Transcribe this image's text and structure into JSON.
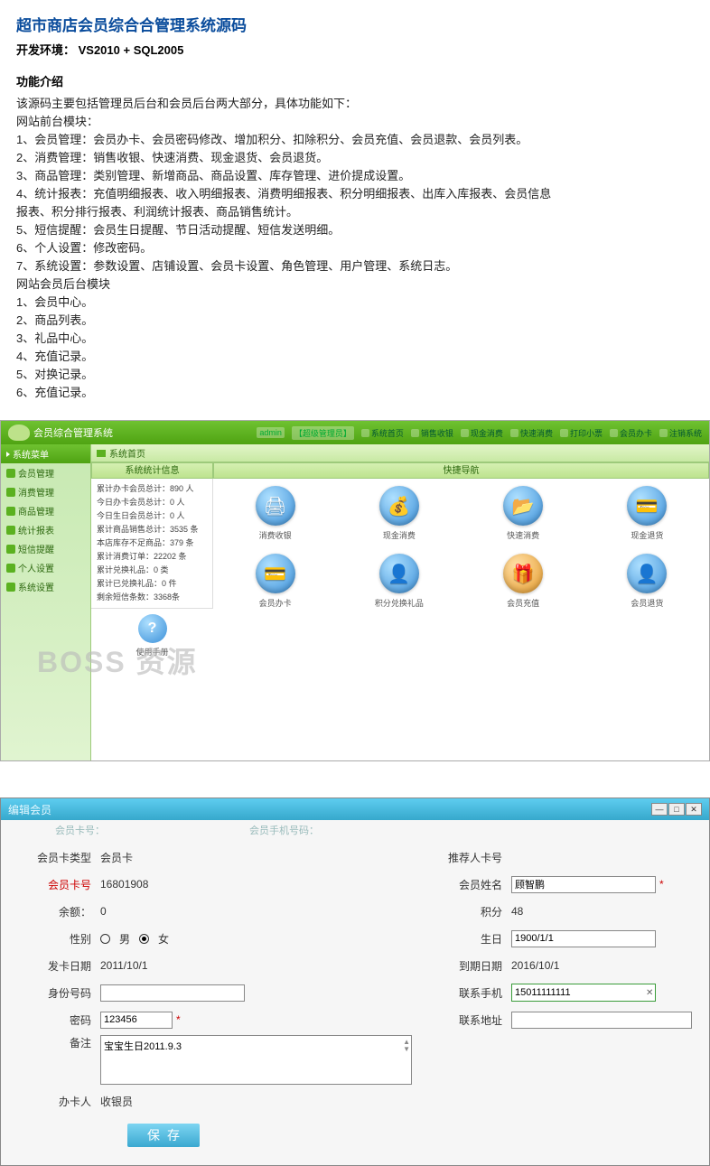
{
  "doc": {
    "title": "超市商店会员综合合管理系统源码",
    "env": "开发环境： VS2010 + SQL2005",
    "section": "功能介绍",
    "lines": [
      "该源码主要包括管理员后台和会员后台两大部分，具体功能如下：",
      "网站前台模块：",
      "1、会员管理：会员办卡、会员密码修改、增加积分、扣除积分、会员充值、会员退款、会员列表。",
      "2、消费管理：销售收银、快速消费、现金退货、会员退货。",
      "3、商品管理：类别管理、新增商品、商品设置、库存管理、进价提成设置。",
      "4、统计报表：充值明细报表、收入明细报表、消费明细报表、积分明细报表、出库入库报表、会员信息",
      "报表、积分排行报表、利润统计报表、商品销售统计。",
      "5、短信提醒：会员生日提醒、节日活动提醒、短信发送明细。",
      "6、个人设置：修改密码。",
      "7、系统设置：参数设置、店铺设置、会员卡设置、角色管理、用户管理、系统日志。",
      "网站会员后台模块",
      "1、会员中心。",
      "2、商品列表。",
      "3、礼品中心。",
      "4、充值记录。",
      "5、对换记录。",
      "6、充值记录。"
    ]
  },
  "shot1": {
    "logo": "会员综合管理系统",
    "top_user": "admin",
    "top_role": "【超级管理员】",
    "top_links": [
      "系统首页",
      "销售收银",
      "现金消费",
      "快速消费",
      "打印小票",
      "会员办卡",
      "注销系统"
    ],
    "side_header": "系统菜单",
    "side_items": [
      "会员管理",
      "消费管理",
      "商品管理",
      "统计报表",
      "短信提醒",
      "个人设置",
      "系统设置"
    ],
    "crumb": "系统首页",
    "split": {
      "left": "系统统计信息",
      "right": "快捷导航"
    },
    "stats": [
      "累计办卡会员总计：890 人",
      "今日办卡会员总计：0 人",
      "今日生日会员总计：0 人",
      "累计商品销售总计：3535 条",
      "本店库存不足商品：379 条",
      "累计消费订单：22202 条",
      "累计兑换礼品：0 类",
      "累计已兑换礼品：0 件",
      "剩余短信条数：3368条"
    ],
    "icons_row1": [
      "消费收银",
      "现金消费",
      "快速消费",
      "现金退货"
    ],
    "icons_row2": [
      "会员办卡",
      "积分兑换礼品",
      "会员充值",
      "会员退货"
    ],
    "help_label": "使用手册",
    "watermark": "BOSS 资源"
  },
  "shot2": {
    "win_title": "编辑会员",
    "faint_left": "会员卡号：",
    "faint_right": "会员手机号码：",
    "left_fields": {
      "card_type_label": "会员卡类型",
      "card_type_value": "会员卡",
      "card_no_label": "会员卡号",
      "card_no_value": "16801908",
      "balance_label": "余额：",
      "balance_value": "0",
      "gender_label": "性别",
      "gender_male": "男",
      "gender_female": "女",
      "issue_label": "发卡日期",
      "issue_value": "2011/10/1",
      "idcard_label": "身份号码",
      "pwd_label": "密码",
      "pwd_value": "123456",
      "remark_label": "备注",
      "remark_value": "宝宝生日2011.9.3",
      "clerk_label": "办卡人",
      "clerk_value": "收银员",
      "save": "保存"
    },
    "right_fields": {
      "ref_label": "推荐人卡号",
      "name_label": "会员姓名",
      "name_value": "顾智鹏",
      "points_label": "积分",
      "points_value": "48",
      "birth_label": "生日",
      "birth_value": "1900/1/1",
      "expire_label": "到期日期",
      "expire_value": "2016/10/1",
      "phone_label": "联系手机",
      "phone_value": "15011111111",
      "addr_label": "联系地址"
    }
  }
}
